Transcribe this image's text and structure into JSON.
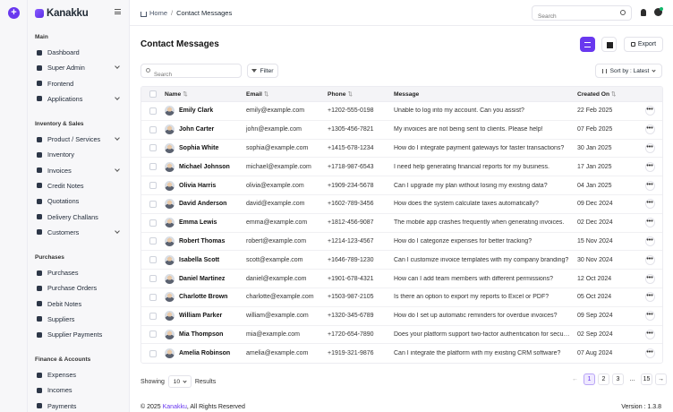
{
  "brand": {
    "name": "Kanakku"
  },
  "sidebar": {
    "sections": [
      {
        "title": "Main",
        "items": [
          {
            "label": "Dashboard",
            "chevron": false
          },
          {
            "label": "Super Admin",
            "chevron": true
          },
          {
            "label": "Frontend",
            "chevron": false
          },
          {
            "label": "Applications",
            "chevron": true
          }
        ]
      },
      {
        "title": "Inventory & Sales",
        "items": [
          {
            "label": "Product / Services",
            "chevron": true
          },
          {
            "label": "Inventory",
            "chevron": false
          },
          {
            "label": "Invoices",
            "chevron": true
          },
          {
            "label": "Credit Notes",
            "chevron": false
          },
          {
            "label": "Quotations",
            "chevron": false
          },
          {
            "label": "Delivery Challans",
            "chevron": false
          },
          {
            "label": "Customers",
            "chevron": true
          }
        ]
      },
      {
        "title": "Purchases",
        "items": [
          {
            "label": "Purchases",
            "chevron": false
          },
          {
            "label": "Purchase Orders",
            "chevron": false
          },
          {
            "label": "Debit Notes",
            "chevron": false
          },
          {
            "label": "Suppliers",
            "chevron": false
          },
          {
            "label": "Supplier Payments",
            "chevron": false
          }
        ]
      },
      {
        "title": "Finance & Accounts",
        "items": [
          {
            "label": "Expenses",
            "chevron": false
          },
          {
            "label": "Incomes",
            "chevron": false
          },
          {
            "label": "Payments",
            "chevron": false
          }
        ]
      }
    ]
  },
  "header": {
    "breadcrumb_home": "Home",
    "breadcrumb_sep": "/",
    "breadcrumb_current": "Contact Messages",
    "search_placeholder": "Search"
  },
  "page": {
    "title": "Contact Messages",
    "export_label": "Export",
    "search_placeholder": "Search",
    "filter_label": "Filter",
    "sort_label": "Sort by : Latest"
  },
  "table": {
    "columns": {
      "name": "Name",
      "email": "Email",
      "phone": "Phone",
      "message": "Message",
      "created": "Created On",
      "sort_glyph": "⇅"
    },
    "more_glyph": "•••",
    "rows": [
      {
        "name": "Emily Clark",
        "email": "emily@example.com",
        "phone": "+1202-555-0198",
        "message": "Unable to log into my account. Can you assist?",
        "date": "22 Feb 2025"
      },
      {
        "name": "John Carter",
        "email": "john@example.com",
        "phone": "+1305-456-7821",
        "message": "My invoices are not being sent to clients. Please help!",
        "date": "07 Feb 2025"
      },
      {
        "name": "Sophia White",
        "email": "sophia@example.com",
        "phone": "+1415-678-1234",
        "message": "How do I integrate payment gateways for faster transactions?",
        "date": "30 Jan 2025"
      },
      {
        "name": "Michael Johnson",
        "email": "michael@example.com",
        "phone": "+1718-987-6543",
        "message": "I need help generating financial reports for my business.",
        "date": "17 Jan 2025"
      },
      {
        "name": "Olivia Harris",
        "email": "olivia@example.com",
        "phone": "+1909-234-5678",
        "message": "Can I upgrade my plan without losing my existing data?",
        "date": "04 Jan 2025"
      },
      {
        "name": "David Anderson",
        "email": "david@example.com",
        "phone": "+1602-789-3456",
        "message": "How does the system calculate taxes automatically?",
        "date": "09 Dec 2024"
      },
      {
        "name": "Emma Lewis",
        "email": "emma@example.com",
        "phone": "+1812-456-9087",
        "message": "The mobile app crashes frequently when generating invoices.",
        "date": "02 Dec 2024"
      },
      {
        "name": "Robert Thomas",
        "email": "robert@example.com",
        "phone": "+1214-123-4567",
        "message": "How do I categorize expenses for better tracking?",
        "date": "15 Nov 2024"
      },
      {
        "name": "Isabella Scott",
        "email": "scott@example.com",
        "phone": "+1646-789-1230",
        "message": "Can I customize invoice templates with my company branding?",
        "date": "30 Nov 2024"
      },
      {
        "name": "Daniel Martinez",
        "email": "daniel@example.com",
        "phone": "+1901-678-4321",
        "message": "How can I add team members with different permissions?",
        "date": "12 Oct 2024"
      },
      {
        "name": "Charlotte Brown",
        "email": "charlotte@example.com",
        "phone": "+1503-987-2105",
        "message": "Is there an option to export my reports to Excel or PDF?",
        "date": "05 Oct 2024"
      },
      {
        "name": "William Parker",
        "email": "william@example.com",
        "phone": "+1320-345-6789",
        "message": "How do I set up automatic reminders for overdue invoices?",
        "date": "09 Sep 2024"
      },
      {
        "name": "Mia Thompson",
        "email": "mia@example.com",
        "phone": "+1720-654-7890",
        "message": "Does your platform support two-factor authentication for security?",
        "date": "02 Sep 2024"
      },
      {
        "name": "Amelia Robinson",
        "email": "amelia@example.com",
        "phone": "+1919-321-9876",
        "message": "Can I integrate the platform with my existing CRM software?",
        "date": "07 Aug 2024"
      }
    ]
  },
  "pagination": {
    "showing_label": "Showing",
    "per_page": "10",
    "results_label": "Results",
    "prev_glyph": "←",
    "pages": [
      "1",
      "2",
      "3",
      "...",
      "15"
    ],
    "next_glyph": "→"
  },
  "footer": {
    "copyright_prefix": "© 2025 ",
    "copyright_brand": "Kanakku",
    "copyright_suffix": ", All Rights Reserved",
    "version": "Version : 1.3.8"
  },
  "colors": {
    "accent": "#6938ef"
  }
}
